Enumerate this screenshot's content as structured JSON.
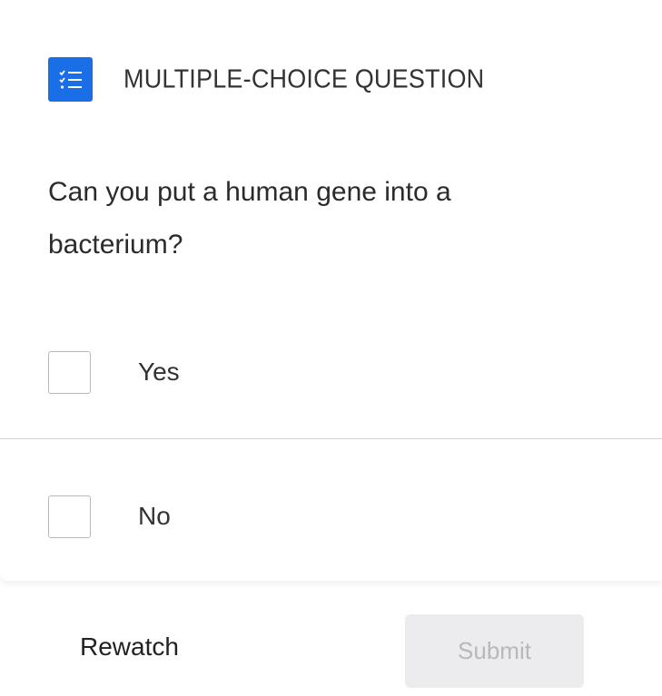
{
  "header": {
    "icon": "checklist-icon",
    "title": "MULTIPLE-CHOICE QUESTION",
    "accent_color": "#1a6fe6"
  },
  "question": {
    "text": "Can you put a human gene into a bacterium?"
  },
  "options": [
    {
      "label": "Yes",
      "checked": false
    },
    {
      "label": "No",
      "checked": false
    }
  ],
  "footer": {
    "rewatch_label": "Rewatch",
    "submit_label": "Submit",
    "submit_disabled": true
  }
}
